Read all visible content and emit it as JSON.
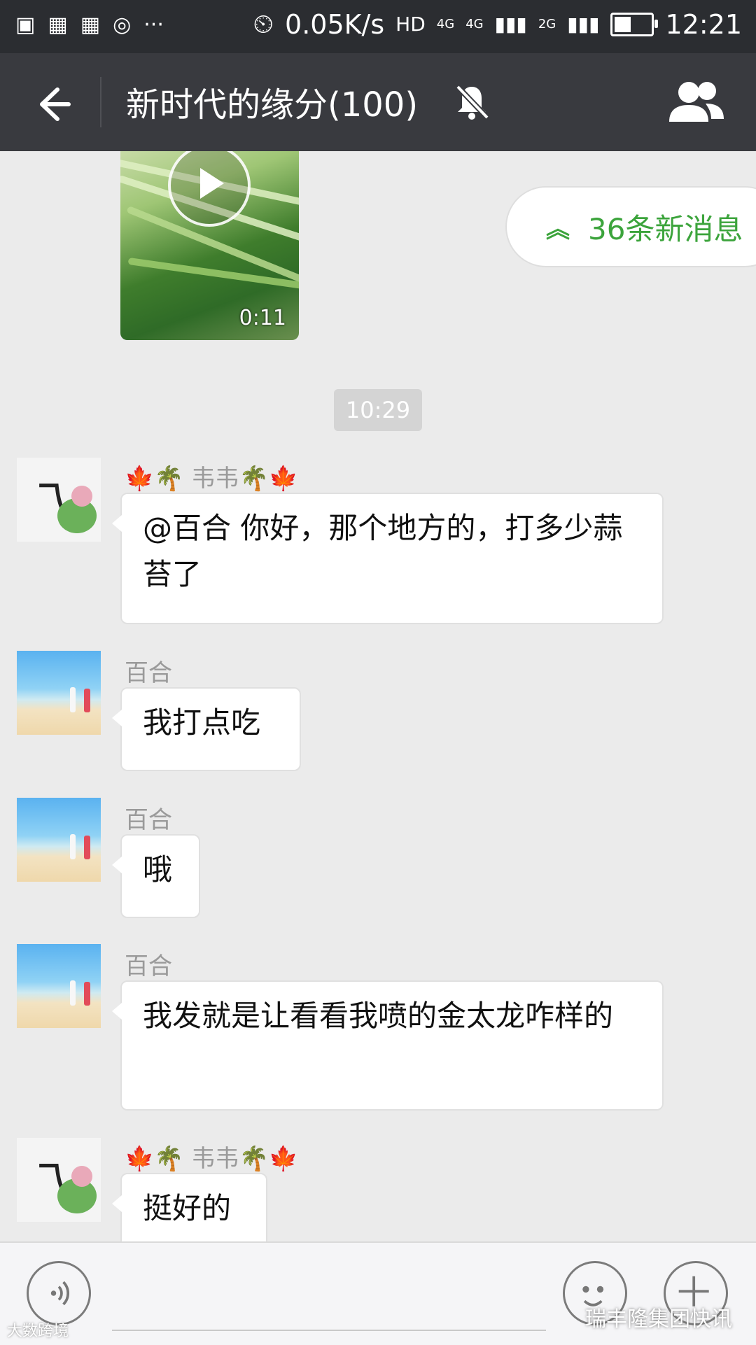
{
  "status_bar": {
    "net_speed": "0.05K/s",
    "hd": "HD",
    "net1": "4G",
    "net2": "4G",
    "net3": "2G",
    "battery_level": 0.45,
    "time": "12:21"
  },
  "title_bar": {
    "title": "新时代的缘分(100)",
    "back_icon": "back-arrow-icon",
    "mute_icon": "bell-muted-icon",
    "group_icon": "group-members-icon"
  },
  "video": {
    "duration": "0:11",
    "icon": "play-icon"
  },
  "new_messages": {
    "label": "36条新消息",
    "icon": "double-chevron-up-icon",
    "color": "#3ca43c"
  },
  "timestamp": "10:29",
  "messages": [
    {
      "sender": "🍁🌴 韦韦🌴🍁",
      "text": "@百合  你好，那个地方的，打多少蒜苔了",
      "avatar": "ink-painting"
    },
    {
      "sender": "百合",
      "text": "我打点吃",
      "avatar": "beach-couple"
    },
    {
      "sender": "百合",
      "text": "哦",
      "avatar": "beach-couple"
    },
    {
      "sender": "百合",
      "text": "我发就是让看看我喷的金太龙咋样的",
      "avatar": "beach-couple"
    },
    {
      "sender": "🍁🌴 韦韦🌴🍁",
      "text": "挺好的",
      "avatar": "ink-painting"
    }
  ],
  "input_bar": {
    "voice_icon": "voice-icon",
    "emoji_icon": "emoji-icon",
    "plus_icon": "plus-icon"
  },
  "watermark": {
    "right": "瑞丰隆集团快讯",
    "left": "大数跨境"
  }
}
